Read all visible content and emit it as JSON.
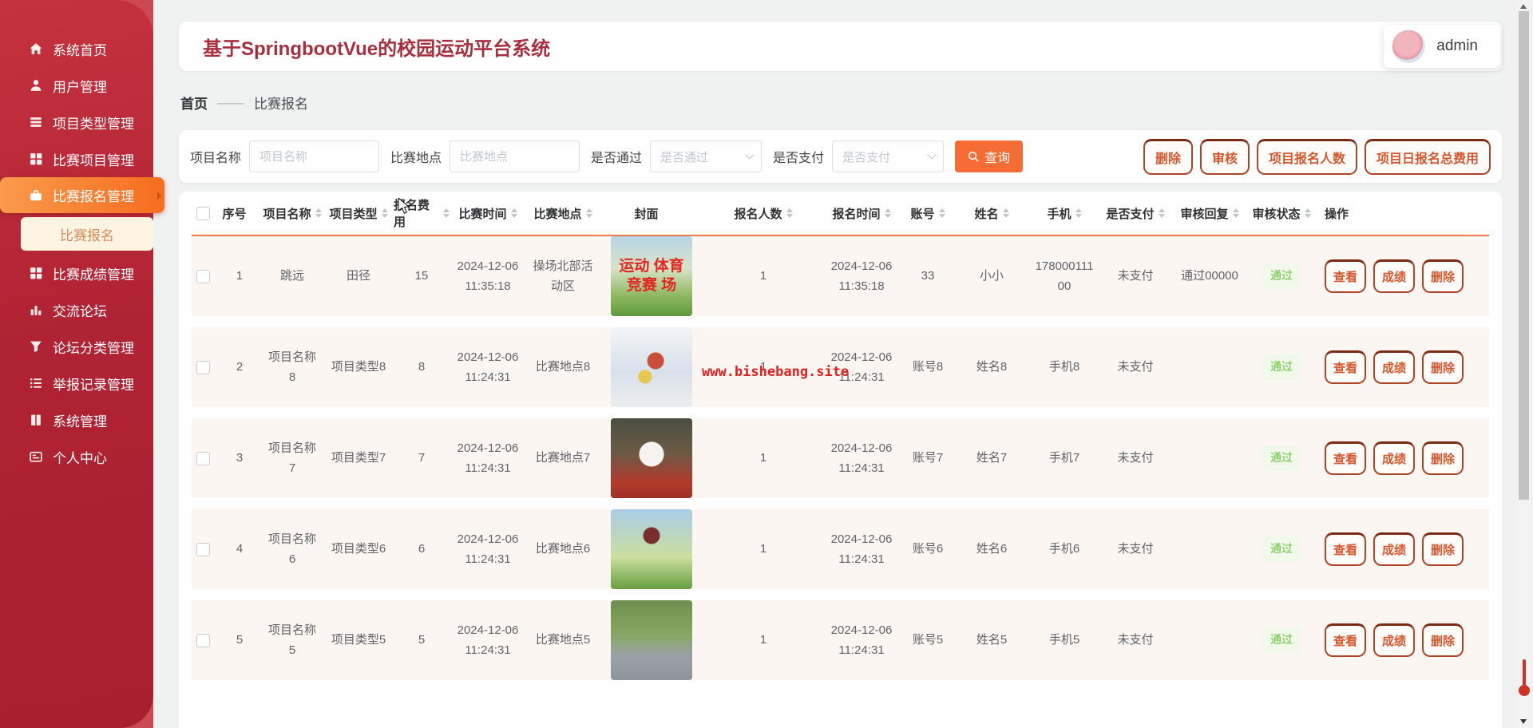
{
  "header": {
    "title": "基于SpringbootVue的校园运动平台系统",
    "username": "admin"
  },
  "breadcrumb": {
    "home": "首页",
    "separator": "——",
    "current": "比赛报名"
  },
  "sidebar": {
    "items": [
      {
        "label": "系统首页"
      },
      {
        "label": "用户管理"
      },
      {
        "label": "项目类型管理"
      },
      {
        "label": "比赛项目管理"
      },
      {
        "label": "比赛报名管理"
      },
      {
        "label": "比赛成绩管理"
      },
      {
        "label": "交流论坛"
      },
      {
        "label": "论坛分类管理"
      },
      {
        "label": "举报记录管理"
      },
      {
        "label": "系统管理"
      },
      {
        "label": "个人中心"
      }
    ],
    "sub_item": {
      "label": "比赛报名"
    }
  },
  "filters": {
    "name_label": "项目名称",
    "name_placeholder": "项目名称",
    "location_label": "比赛地点",
    "location_placeholder": "比赛地点",
    "pass_label": "是否通过",
    "pass_placeholder": "是否通过",
    "pay_label": "是否支付",
    "pay_placeholder": "是否支付",
    "search_label": "查询"
  },
  "toolbar": {
    "buttons": [
      {
        "label": "删除"
      },
      {
        "label": "审核"
      },
      {
        "label": "项目报名人数"
      },
      {
        "label": "项目日报名总费用"
      }
    ]
  },
  "table": {
    "columns": [
      {
        "label": "序号",
        "key": "c-no",
        "sort": ""
      },
      {
        "label": "项目名称",
        "key": "c-name",
        "sort": "sort-on"
      },
      {
        "label": "项目类型",
        "key": "c-type",
        "sort": "sort-on"
      },
      {
        "label": "报名费用",
        "key": "c-fee",
        "sort": "sort-on"
      },
      {
        "label": "比赛时间",
        "key": "c-time",
        "sort": "sort-on"
      },
      {
        "label": "比赛地点",
        "key": "c-loc",
        "sort": "sort-on"
      },
      {
        "label": "封面",
        "key": "c-cover",
        "sort": ""
      },
      {
        "label": "报名人数",
        "key": "c-count",
        "sort": "sort-on"
      },
      {
        "label": "报名时间",
        "key": "c-rtime",
        "sort": "sort-on"
      },
      {
        "label": "账号",
        "key": "c-acc",
        "sort": "sort-on"
      },
      {
        "label": "姓名",
        "key": "c-pname",
        "sort": "sort-on"
      },
      {
        "label": "手机",
        "key": "c-phone",
        "sort": "sort-on"
      },
      {
        "label": "是否支付",
        "key": "c-paid",
        "sort": "sort-on"
      },
      {
        "label": "审核回复",
        "key": "c-reply",
        "sort": "sort-on"
      },
      {
        "label": "审核状态",
        "key": "c-status",
        "sort": "sort-on"
      },
      {
        "label": "操作",
        "key": "c-ops",
        "sort": ""
      }
    ],
    "actions": [
      "查看",
      "成绩",
      "删除"
    ],
    "rows": [
      {
        "no": "1",
        "name": "跳远",
        "type": "田径",
        "fee": "15",
        "time": "2024-12-06 11:35:18",
        "location": "操场北部活动区",
        "cover_class": "cover-field",
        "cover_text": "运动 体育竞赛 场",
        "count": "1",
        "reg_time": "2024-12-06 11:35:18",
        "account": "33",
        "person": "小小",
        "phone": "17800011100",
        "paid": "未支付",
        "reply": "通过00000",
        "status": "通过"
      },
      {
        "no": "2",
        "name": "项目名称8",
        "type": "项目类型8",
        "fee": "8",
        "time": "2024-12-06 11:24:31",
        "location": "比赛地点8",
        "cover_class": "cover-ski",
        "cover_text": "",
        "count": "1",
        "reg_time": "2024-12-06 11:24:31",
        "account": "账号8",
        "person": "姓名8",
        "phone": "手机8",
        "paid": "未支付",
        "reply": "",
        "status": "通过"
      },
      {
        "no": "3",
        "name": "项目名称7",
        "type": "项目类型7",
        "fee": "7",
        "time": "2024-12-06 11:24:31",
        "location": "比赛地点7",
        "cover_class": "cover-baseball",
        "cover_text": "",
        "count": "1",
        "reg_time": "2024-12-06 11:24:31",
        "account": "账号7",
        "person": "姓名7",
        "phone": "手机7",
        "paid": "未支付",
        "reply": "",
        "status": "通过"
      },
      {
        "no": "4",
        "name": "项目名称6",
        "type": "项目类型6",
        "fee": "6",
        "time": "2024-12-06 11:24:31",
        "location": "比赛地点6",
        "cover_class": "cover-parkour",
        "cover_text": "",
        "count": "1",
        "reg_time": "2024-12-06 11:24:31",
        "account": "账号6",
        "person": "姓名6",
        "phone": "手机6",
        "paid": "未支付",
        "reply": "",
        "status": "通过"
      },
      {
        "no": "5",
        "name": "项目名称5",
        "type": "项目类型5",
        "fee": "5",
        "time": "2024-12-06 11:24:31",
        "location": "比赛地点5",
        "cover_class": "cover-cycling",
        "cover_text": "",
        "count": "1",
        "reg_time": "2024-12-06 11:24:31",
        "account": "账号5",
        "person": "姓名5",
        "phone": "手机5",
        "paid": "未支付",
        "reply": "",
        "status": "通过"
      }
    ]
  },
  "watermark": {
    "text": "www.bishebang.site"
  },
  "colors": {
    "sidebar_red": "#b02334",
    "active_orange": "#f66d1e",
    "accent_orange": "#f56c34",
    "title_red": "#a72f3e",
    "header_underline": "#f07850",
    "badge_green": "#67c23a",
    "watermark_red": "#e01f1f",
    "scroll_pin_red": "#d03224"
  }
}
